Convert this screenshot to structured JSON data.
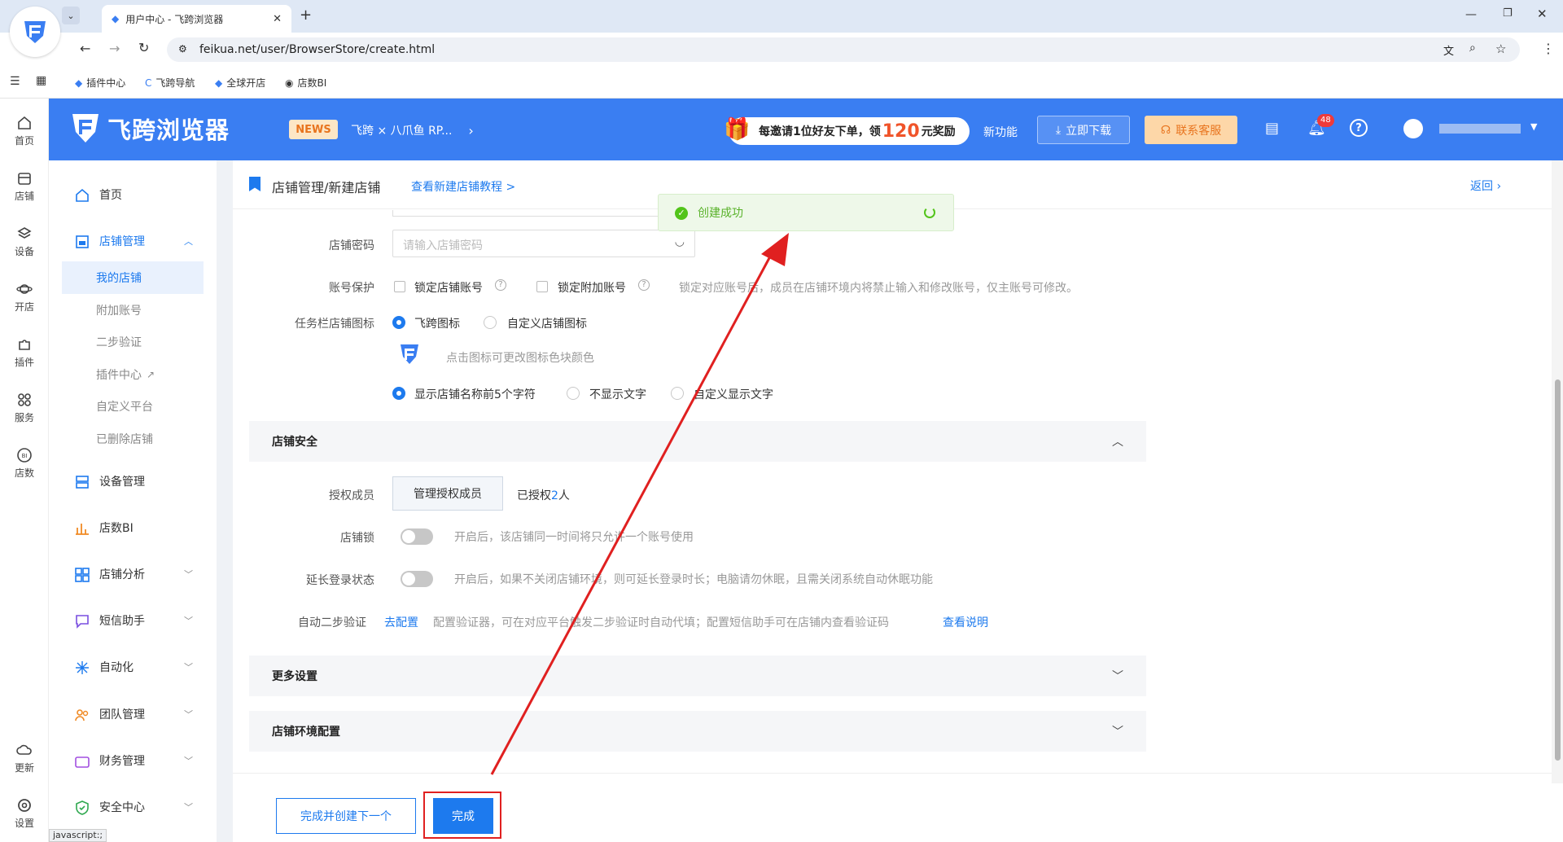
{
  "browser": {
    "tab_title": "用户中心 - 飞跨浏览器",
    "url": "feikua.net/user/BrowserStore/create.html",
    "bookmarks": [
      "插件中心",
      "飞跨导航",
      "全球开店",
      "店数BI"
    ]
  },
  "rail": [
    {
      "label": "首页",
      "icon": "home-icon"
    },
    {
      "label": "店铺",
      "icon": "store-icon"
    },
    {
      "label": "设备",
      "icon": "layers-icon"
    },
    {
      "label": "开店",
      "icon": "planet-icon"
    },
    {
      "label": "插件",
      "icon": "puzzle-icon"
    },
    {
      "label": "服务",
      "icon": "grid-icon"
    },
    {
      "label": "店数",
      "icon": "bi-icon"
    },
    {
      "label": "更新",
      "icon": "cloud-icon"
    },
    {
      "label": "设置",
      "icon": "gear-icon"
    }
  ],
  "header": {
    "logo": "飞跨浏览器",
    "news_badge": "NEWS",
    "news_text": "飞跨 × 八爪鱼 RP...",
    "invite_prefix": "每邀请1位好友下单，领",
    "invite_amount": "120",
    "invite_suffix": "元奖励",
    "new_feature": "新功能",
    "download": "立即下载",
    "contact": "联系客服",
    "notification_count": "48"
  },
  "menu": {
    "items": [
      {
        "label": "首页"
      },
      {
        "label": "店铺管理"
      },
      {
        "label": "设备管理"
      },
      {
        "label": "店数BI"
      },
      {
        "label": "店铺分析"
      },
      {
        "label": "短信助手"
      },
      {
        "label": "自动化"
      },
      {
        "label": "团队管理"
      },
      {
        "label": "财务管理"
      },
      {
        "label": "安全中心"
      }
    ],
    "sub": [
      "我的店铺",
      "附加账号",
      "二步验证",
      "插件中心",
      "自定义平台",
      "已删除店铺"
    ]
  },
  "breadcrumb": {
    "title": "店铺管理/新建店铺",
    "tutorial": "查看新建店铺教程 >",
    "back": "返回"
  },
  "form": {
    "password_label": "店铺密码",
    "password_placeholder": "请输入店铺密码",
    "protect_label": "账号保护",
    "lock_store": "锁定店铺账号",
    "lock_extra": "锁定附加账号",
    "protect_hint": "锁定对应账号后，成员在店铺环境内将禁止输入和修改账号，仅主账号可修改。",
    "taskbar_label": "任务栏店铺图标",
    "icon_feikua": "飞跨图标",
    "icon_custom": "自定义店铺图标",
    "icon_hint": "点击图标可更改图标色块颜色",
    "text_opt1": "显示店铺名称前5个字符",
    "text_opt2": "不显示文字",
    "text_opt3": "自定义显示文字",
    "security_title": "店铺安全",
    "member_label": "授权成员",
    "member_button": "管理授权成员",
    "member_prefix": "已授权",
    "member_count": "2",
    "member_suffix": "人",
    "lock_label": "店铺锁",
    "lock_hint": "开启后，该店铺同一时间将只允许一个账号使用",
    "extend_label": "延长登录状态",
    "extend_hint": "开启后，如果不关闭店铺环境，则可延长登录时长；电脑请勿休眠，且需关闭系统自动休眠功能",
    "auto2fa_label": "自动二步验证",
    "auto2fa_link": "去配置",
    "auto2fa_hint": "配置验证器，可在对应平台触发二步验证时自动代填；配置短信助手可在店铺内查看验证码",
    "auto2fa_more": "查看说明",
    "more_settings": "更多设置",
    "env_config": "店铺环境配置"
  },
  "footer": {
    "create_next": "完成并创建下一个",
    "finish": "完成"
  },
  "toast": {
    "text": "创建成功"
  },
  "status_text": "javascript:;",
  "colors": {
    "primary": "#3a7ef2",
    "accent": "#1d7aee",
    "annotation": "#e02020"
  }
}
